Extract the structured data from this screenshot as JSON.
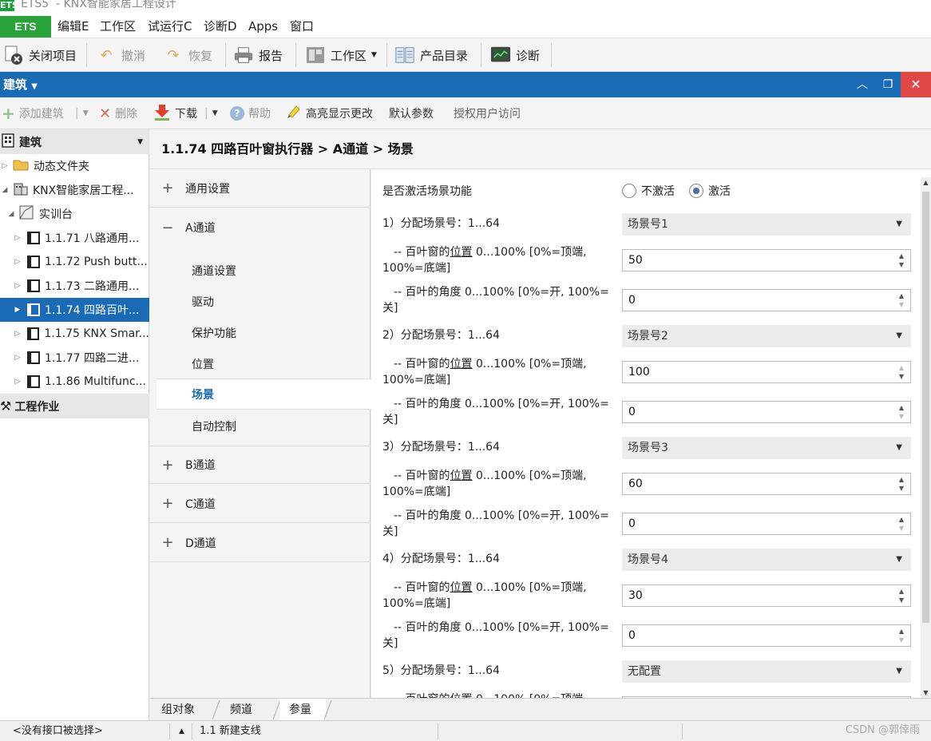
{
  "window": {
    "title": "ETS5  - KNX智能家居工程设计"
  },
  "menu": {
    "ets": "ETS",
    "items": [
      "编辑E",
      "工作区",
      "试运行C",
      "诊断D",
      "Apps",
      "窗口"
    ]
  },
  "toolbar": {
    "close_project": "关闭项目",
    "undo": "撤消",
    "redo": "恢复",
    "report": "报告",
    "workspace": "工作区",
    "product_catalog": "产品目录",
    "diagnostics": "诊断"
  },
  "panel": {
    "title": "建筑"
  },
  "subtoolbar": {
    "add_building": "添加建筑",
    "delete": "删除",
    "download": "下载",
    "help": "帮助",
    "highlight_changes": "高亮显示更改",
    "default_params": "默认参数",
    "authorize_access": "授权用户访问"
  },
  "tree": {
    "header": "建筑",
    "dynamic_folder": "动态文件夹",
    "project": "KNX智能家居工程...",
    "room": "实训台",
    "devices": [
      {
        "label": "1.1.71 八路通用..."
      },
      {
        "label": "1.1.72 Push butt..."
      },
      {
        "label": "1.1.73 二路通用..."
      },
      {
        "label": "1.1.74 四路百叶..."
      },
      {
        "label": "1.1.75 KNX Smar..."
      },
      {
        "label": "1.1.77 四路二进..."
      },
      {
        "label": "1.1.86 Multifunc..."
      }
    ],
    "footer": "工程作业"
  },
  "breadcrumb": "1.1.74 四路百叶窗执行器 > A通道 > 场景",
  "nav": {
    "general": "通用设置",
    "channel_a": "A通道",
    "sub": [
      "通道设置",
      "驱动",
      "保护功能",
      "位置",
      "场景",
      "自动控制"
    ],
    "channel_b": "B通道",
    "channel_c": "C通道",
    "channel_d": "D通道"
  },
  "params": {
    "activate_label": "是否激活场景功能",
    "opt_off": "不激活",
    "opt_on": "激活",
    "pos_prefix": "-- 百叶窗的",
    "pos_underlined": "位置",
    "pos_rest": " 0...100% [0%=顶端, 100%=底端]",
    "angle_label": "-- 百叶的角度 0...100% [0%=开, 100%=关]",
    "scenes": [
      {
        "label": "1）分配场景号：1...64",
        "combo": "场景号1",
        "position": "50",
        "angle": "0"
      },
      {
        "label": "2）分配场景号：1...64",
        "combo": "场景号2",
        "position": "100",
        "angle": "0"
      },
      {
        "label": "3）分配场景号：1...64",
        "combo": "场景号3",
        "position": "60",
        "angle": "0"
      },
      {
        "label": "4）分配场景号：1...64",
        "combo": "场景号4",
        "position": "30",
        "angle": "0"
      },
      {
        "label": "5）分配场景号：1...64",
        "combo": "无配置"
      }
    ],
    "partial_label": "-- 百叶窗的位置 0...100% [0%=顶端,"
  },
  "bottom_tabs": [
    "组对象",
    "频道",
    "参量"
  ],
  "status": {
    "interface": "<没有接口被选择>",
    "line": "1.1 新建支线",
    "watermark": "CSDN @郭倖雨"
  }
}
